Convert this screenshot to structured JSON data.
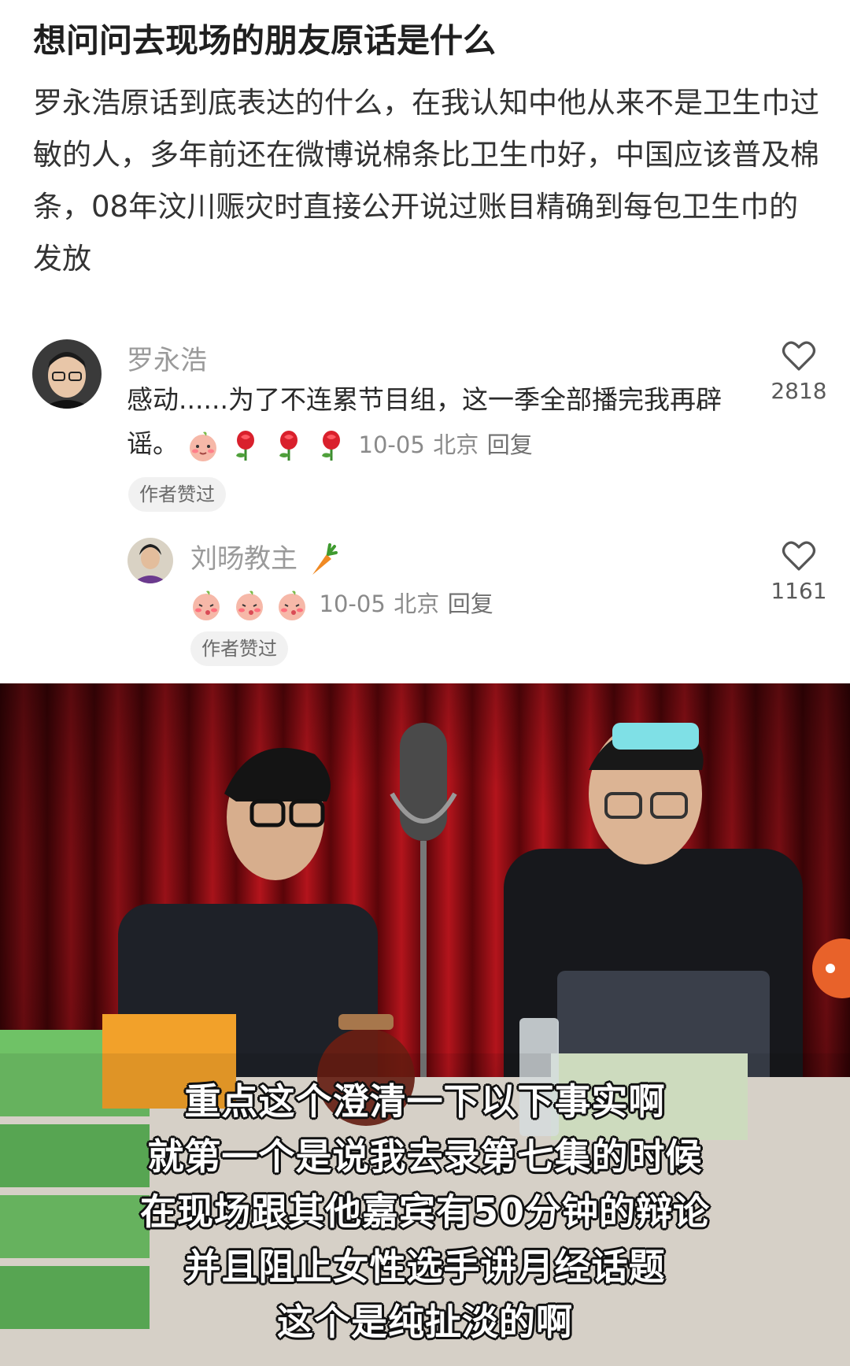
{
  "post": {
    "title": "想问问去现场的朋友原话是什么",
    "body": "罗永浩原话到底表达的什么，在我认知中他从来不是卫生巾过敏的人，多年前还在微博说棉条比卫生巾好，中国应该普及棉条，08年汶川赈灾时直接公开说过账目精确到每包卫生巾的发放"
  },
  "comments": [
    {
      "author": "罗永浩",
      "text": "感动......为了不连累节目组，这一季全部播完我再辟谣。",
      "date": "10-05",
      "location": "北京",
      "reply_label": "回复",
      "tag": "作者赞过",
      "likes": "2818"
    },
    {
      "author": "刘旸教主",
      "date": "10-05",
      "location": "北京",
      "reply_label": "回复",
      "tag": "作者赞过",
      "likes": "1161"
    }
  ],
  "video": {
    "subtitles": [
      "重点这个澄清一下以下事实啊",
      "就第一个是说我去录第七集的时候",
      "在现场跟其他嘉宾有50分钟的辩论",
      "并且阻止女性选手讲月经话题",
      "这个是纯扯淡的啊"
    ]
  },
  "colors": {
    "curtain": "#8b0b12",
    "like_icon": "#555555"
  },
  "icons": [
    "heart-icon",
    "carrot-emoji",
    "rose-emoji",
    "blush-face-emoji"
  ]
}
